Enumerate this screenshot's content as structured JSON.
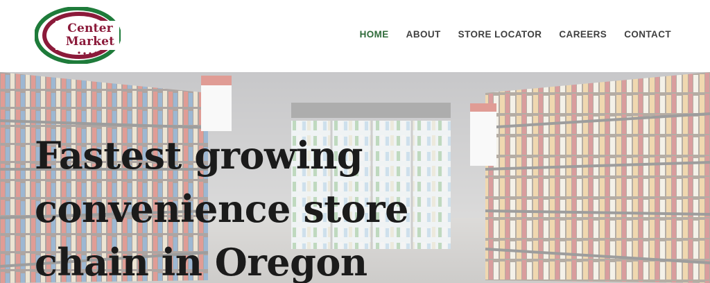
{
  "logo": {
    "line1": "Center",
    "line2": "Market",
    "colors": {
      "maroon": "#8b1a3a",
      "green": "#1e7b3a"
    }
  },
  "nav": {
    "items": [
      {
        "label": "HOME",
        "active": true
      },
      {
        "label": "ABOUT",
        "active": false
      },
      {
        "label": "STORE LOCATOR",
        "active": false
      },
      {
        "label": "CAREERS",
        "active": false
      },
      {
        "label": "CONTACT",
        "active": false
      }
    ],
    "active_color": "#2f6b3a",
    "text_color": "#3f3f3f"
  },
  "hero": {
    "headline_lines": [
      "Fastest growing",
      "convenience store",
      "chain in Oregon"
    ],
    "background_image": "grocery-store-aisle-photo",
    "overlay_color": "rgba(255,255,255,0.5)"
  }
}
